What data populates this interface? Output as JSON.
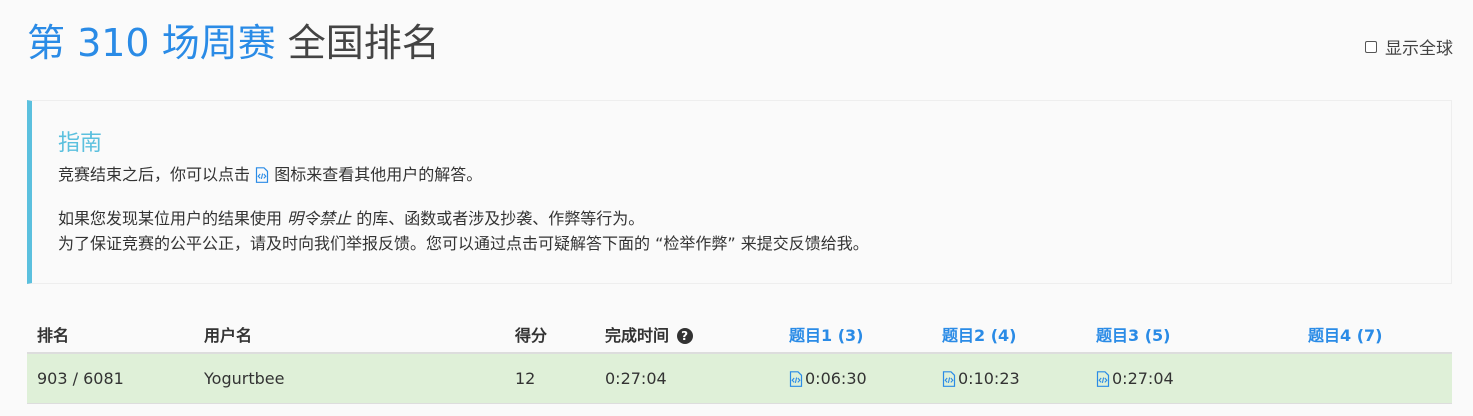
{
  "header": {
    "contest_label": "第 310 场周赛",
    "title_suffix": "全国排名",
    "show_global_label": "显示全球"
  },
  "guide": {
    "title": "指南",
    "line1_before": "竞赛结束之后，你可以点击",
    "line1_after": "图标来查看其他用户的解答。",
    "line2_before": "如果您发现某位用户的结果使用",
    "line2_em": "明令禁止",
    "line2_after": "的库、函数或者涉及抄袭、作弊等行为。",
    "line3": "为了保证竞赛的公平公正，请及时向我们举报反馈。您可以通过点击可疑解答下面的 “检举作弊” 来提交反馈给我。"
  },
  "table": {
    "headers": {
      "rank": "排名",
      "username": "用户名",
      "score": "得分",
      "finish_time": "完成时间",
      "q1": "题目1 (3)",
      "q2": "题目2 (4)",
      "q3": "题目3 (5)",
      "q4": "题目4 (7)"
    },
    "row": {
      "rank": "903 / 6081",
      "username": "Yogurtbee",
      "score": "12",
      "finish_time": "0:27:04",
      "q1": "0:06:30",
      "q2": "0:10:23",
      "q3": "0:27:04",
      "q4": ""
    }
  },
  "colors": {
    "accent": "#2a8be6",
    "guide_border": "#5bc0de",
    "row_success": "#dff0d8"
  },
  "icons": {
    "solution": "code-file-icon",
    "help": "question-circle-icon",
    "checkbox": "checkbox-unchecked"
  }
}
